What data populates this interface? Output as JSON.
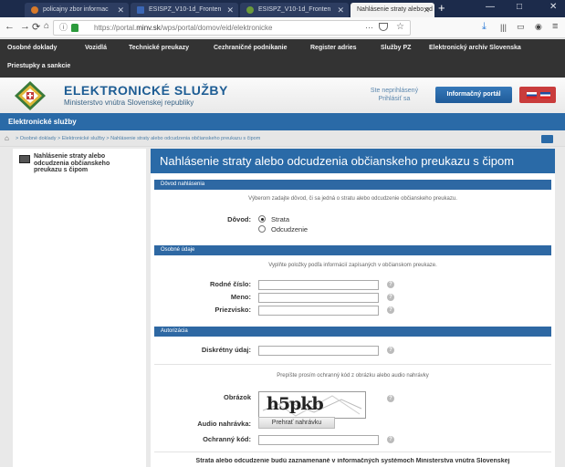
{
  "browser": {
    "tabs": [
      {
        "title": "policajny zbor informac",
        "icon_color": "#d87a2a",
        "active": false
      },
      {
        "title": "ESISPZ_V10-1d_Fronten",
        "icon_color": "#3a66b5",
        "active": false
      },
      {
        "title": "ESISPZ_V10-1d_Fronten",
        "icon_color": "#6a9a3a",
        "active": false
      },
      {
        "title": "Nahlásenie straty alebo od",
        "icon_color": "#cccccc",
        "active": true
      }
    ],
    "new_tab": "+",
    "url_prefix": "https://portal.",
    "url_domain": "minv.sk",
    "url_path": "/wps/portal/domov/eid/elektronicke",
    "url_more": "···"
  },
  "topmenu": {
    "items": [
      "Osobné doklady",
      "Vozidlá",
      "Technické preukazy",
      "Cezhraničné podnikanie",
      "Register adries",
      "Služby PZ",
      "Elektronický archív Slovenska"
    ],
    "row2": "Priestupky a sankcie"
  },
  "header": {
    "brand_title": "ELEKTRONICKÉ SLUŽBY",
    "brand_subtitle": "Ministerstvo vnútra Slovenskej republiky",
    "login_status": "Ste neprihlásený",
    "login_link": "Prihlásiť sa",
    "portal_button": "Informačný portál"
  },
  "navbar_title": "Elektronické služby",
  "breadcrumb": "> Osobné doklady > Elektronické služby > Nahlásenie straty alebo odcudzenia občianskeho preukazu s čipom",
  "sidebar": {
    "item_label": "Nahlásenie straty alebo odcudzenia občianskeho preukazu s čipom"
  },
  "content": {
    "title": "Nahlásenie straty alebo odcudzenia občianskeho preukazu s čipom",
    "section_reason": "Dôvod nahlásenia",
    "reason_note": "Výberom zadajte dôvod, či sa jedná o stratu alebo odcudzenie občianskeho preukazu.",
    "reason_label": "Dôvod:",
    "reason_options": [
      "Strata",
      "Odcudzenie"
    ],
    "reason_selected": "Strata",
    "section_personal": "Osobné údaje",
    "personal_note": "Vyplňte položky podľa informácií zapísaných v občianskom preukaze.",
    "field_birth": "Rodné číslo:",
    "field_name": "Meno:",
    "field_surname": "Priezvisko:",
    "section_auth": "Autorizácia",
    "field_secret": "Diskrétny údaj:",
    "captcha_note": "Prepíšte prosím ochranný kód z obrázku alebo audio nahrávky",
    "captcha_label": "Obrázok",
    "captcha_text": "h5pkb",
    "audio_label": "Audio nahrávka:",
    "audio_button": "Prehrať nahrávku",
    "code_label": "Ochranný kód:",
    "bottom_text": "Strata alebo odcudzenie budú zaznamenané v informačných systémoch Ministerstva vnútra Slovenskej"
  }
}
